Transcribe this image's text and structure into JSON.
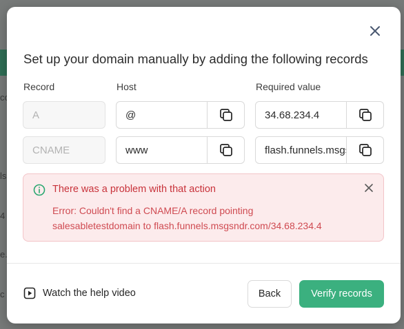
{
  "background": {
    "fragments": [
      "co",
      "ls",
      "4",
      "e.",
      "c"
    ]
  },
  "modal": {
    "title": "Set up your domain manually by adding the following records",
    "columns": {
      "record": "Record",
      "host": "Host",
      "value": "Required value"
    },
    "rows": [
      {
        "record": "A",
        "host": "@",
        "value": "34.68.234.4"
      },
      {
        "record": "CNAME",
        "host": "www",
        "value": "flash.funnels.msgsndr.com"
      }
    ],
    "alert": {
      "title": "There was a problem with that action",
      "line1": "Error: Couldn't find a CNAME/A record pointing",
      "line2": "salesabletestdomain to flash.funnels.msgsndr.com/34.68.234.4"
    },
    "footer": {
      "help_label": "Watch the help video",
      "back_label": "Back",
      "verify_label": "Verify records"
    }
  },
  "colors": {
    "accent": "#3bb07f",
    "error_text": "#c8323a",
    "error_bg": "#fcebec"
  }
}
